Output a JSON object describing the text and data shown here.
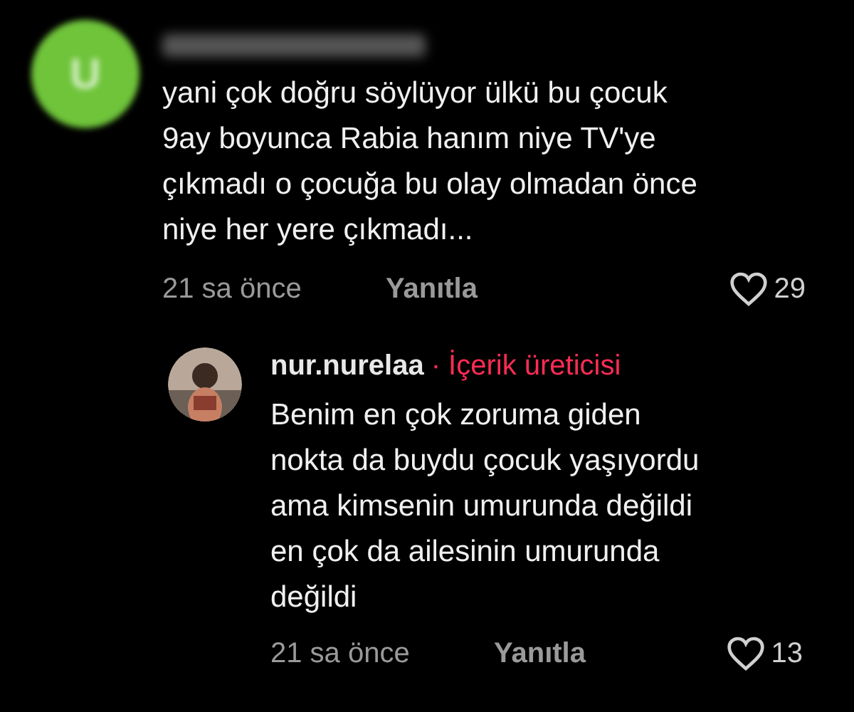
{
  "comment": {
    "avatar_letter": "U",
    "text": "yani çok doğru söylüyor ülkü bu çocuk\n9ay boyunca Rabia hanım niye TV'ye\nçıkmadı o çocuğa bu olay olmadan önce\nniye her yere çıkmadı...",
    "time": "21 sa önce",
    "reply": "Yanıtla",
    "likes": "29"
  },
  "reply": {
    "username": "nur.nurelaa",
    "badge": "· İçerik üreticisi",
    "text": "Benim en çok zoruma giden\nnokta da buydu çocuk yaşıyordu\nama kimsenin umurunda değildi\nen çok da ailesinin umurunda\ndeğildi",
    "time": "21 sa önce",
    "reply": "Yanıtla",
    "likes": "13"
  }
}
